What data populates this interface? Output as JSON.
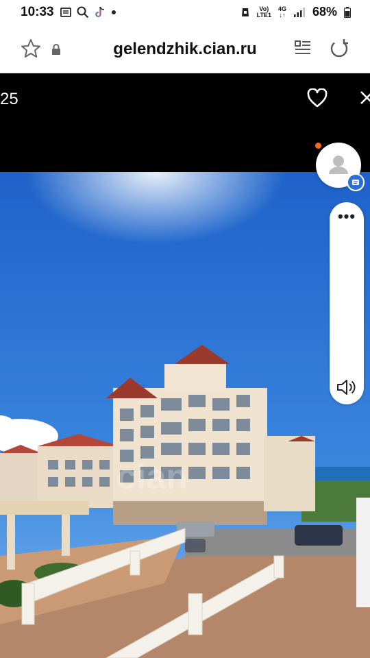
{
  "status_bar": {
    "time": "10:33",
    "battery": "68%",
    "network_top": "Vo)",
    "network_bottom": "LTE1",
    "signal_label": "4G",
    "icons": [
      "message-icon",
      "search-icon",
      "tiktok-icon",
      "dot-icon",
      "alarm-icon",
      "signal-icon",
      "battery-icon"
    ]
  },
  "browser": {
    "url": "gelendzhik.cian.ru",
    "icons": [
      "star-icon",
      "lock-icon",
      "menu-icon",
      "reload-icon"
    ]
  },
  "viewer": {
    "counter": "25",
    "watermark": "cian",
    "icons": [
      "heart-icon",
      "close-icon"
    ]
  },
  "floating": {
    "icons": [
      "avatar-icon",
      "message-badge-icon",
      "more-icon",
      "volume-icon"
    ],
    "more_label": "•••"
  },
  "colors": {
    "sky": "#2d6fd0",
    "accent_orange": "#f06a1a",
    "badge_blue": "#2a6fd6"
  }
}
